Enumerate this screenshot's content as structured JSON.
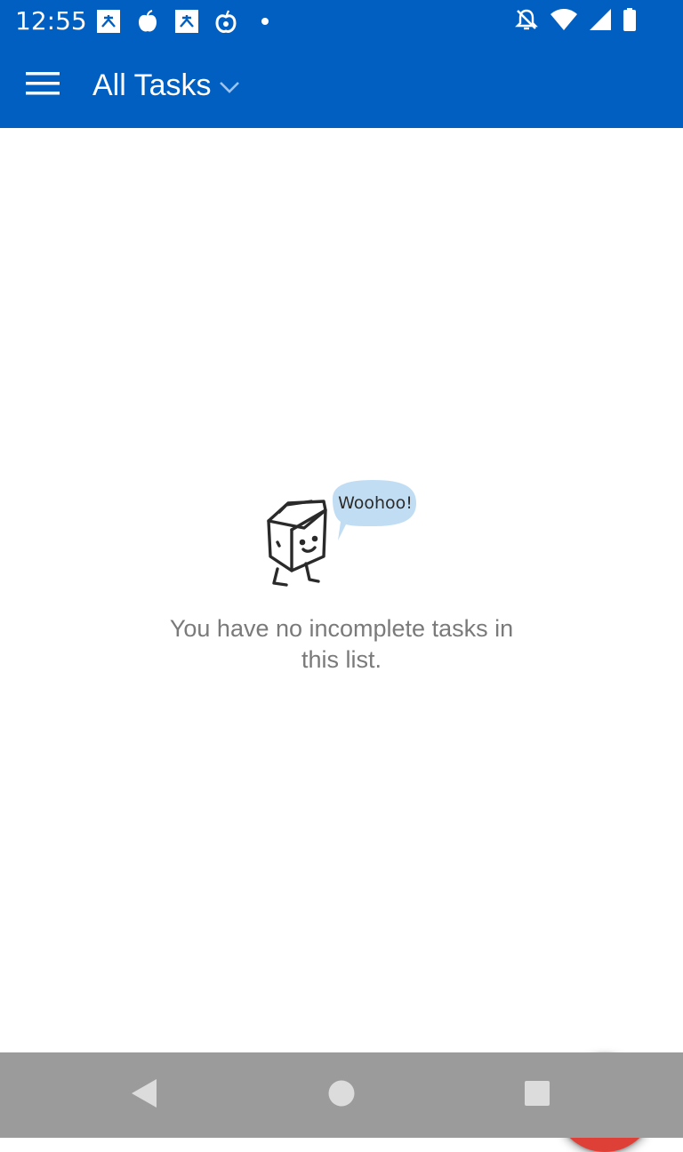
{
  "status_bar": {
    "time": "12:55",
    "left_icons": [
      "tasks-app-icon",
      "apple-icon",
      "tasks-app-icon",
      "fruit-icon",
      "dot-icon"
    ],
    "right_icons": [
      "notifications-off-icon",
      "wifi-icon",
      "signal-icon",
      "battery-icon"
    ]
  },
  "app_bar": {
    "title": "All Tasks",
    "menu_icon": "hamburger-menu-icon",
    "dropdown_icon": "chevron-down-icon",
    "background_color": "#005fc1"
  },
  "empty_state": {
    "illustration": "milk-carton-mascot",
    "speech_bubble_text": "Woohoo!",
    "message": "You have no incomplete tasks in this list."
  },
  "fab": {
    "icon": "plus-icon",
    "color": "#de4037"
  },
  "nav_bar": {
    "icons": [
      "back-icon",
      "home-icon",
      "recents-icon"
    ]
  }
}
